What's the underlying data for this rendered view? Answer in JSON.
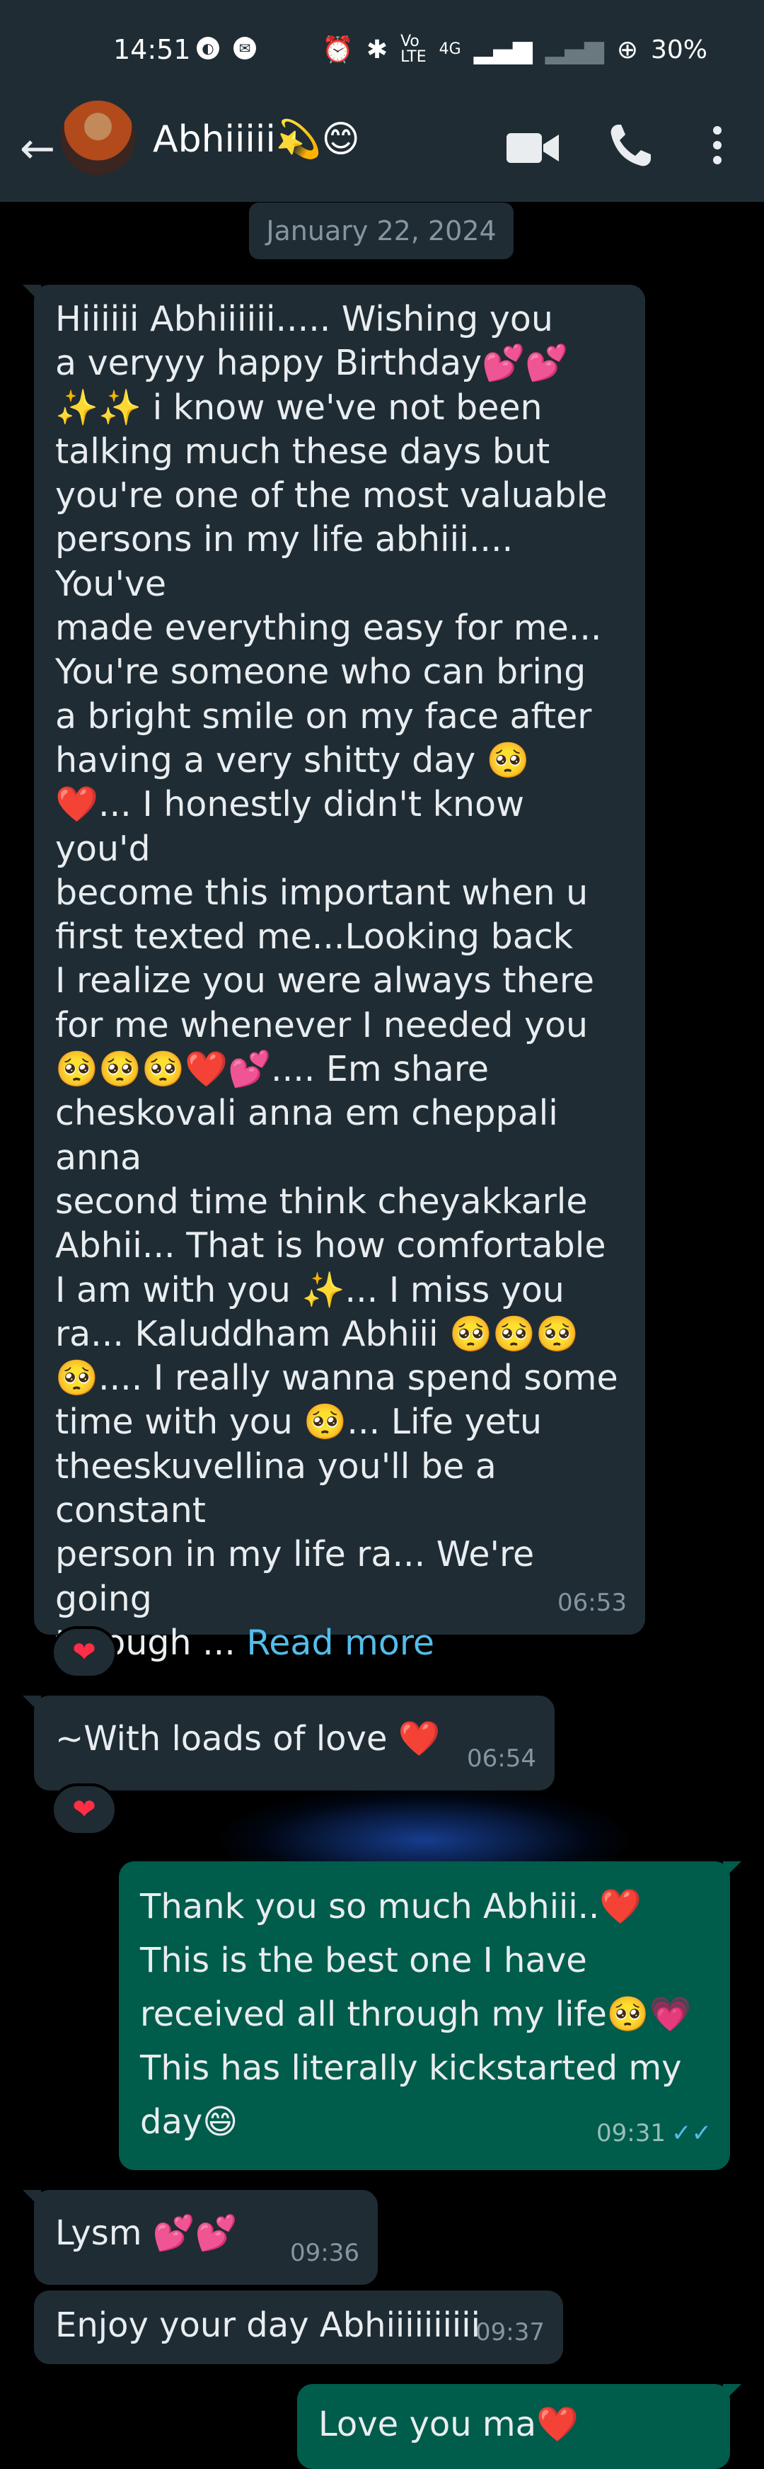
{
  "status_bar": {
    "time": "14:51",
    "lte": "Vo\nLTE",
    "net": "4G",
    "battery": "30%"
  },
  "header": {
    "contact_name": "Abhiiiii💫😊"
  },
  "date_chip": "January 22, 2024",
  "messages": [
    {
      "text": "Hiiiiii Abhiiiiii..... Wishing you\na veryyy happy Birthday💕💕\n✨✨ i know we've not been\ntalking much these days but\nyou're one of the most valuable\npersons in my life abhiii.... You've\nmade everything easy for me...\nYou're someone who can bring\na bright smile on my face after\nhaving a very shitty day 🥺\n❤️... I honestly didn't know you'd\nbecome this important when u\nfirst texted me...Looking back\nI realize you were always there\nfor me whenever I needed you\n🥺🥺🥺❤️💕.... Em share\ncheskovali anna em cheppali anna\nsecond time think cheyakkarle\nAbhii... That is how comfortable\nI am with you ✨... I miss you\nra... Kaluddham Abhiii 🥺🥺🥺\n🥺.... I really wanna spend some\ntime with you 🥺... Life yetu\ntheeskuvellina you'll be a constant\nperson in my life ra... We're going\nthrough ... ",
      "read_more": "Read more",
      "time": "06:53",
      "reaction": "❤"
    },
    {
      "text": "~With loads of love ❤️",
      "time": "06:54",
      "reaction": "❤"
    },
    {
      "text": "Thank you so much Abhiii..❤️\nThis is the best one I have\nreceived all through my life🥺💗\nThis has literally kickstarted my\nday😄",
      "time": "09:31",
      "ticks": "✓✓"
    },
    {
      "text": "Lysm 💕💕",
      "time": "09:36"
    },
    {
      "text": "Enjoy your day Abhiiiiiiiiii",
      "time": "09:37"
    },
    {
      "text": "Love you ma❤️"
    }
  ],
  "colors": {
    "incoming": "#1f2c34",
    "outgoing": "#005c4b",
    "link": "#53bdeb",
    "background": "#000000"
  }
}
